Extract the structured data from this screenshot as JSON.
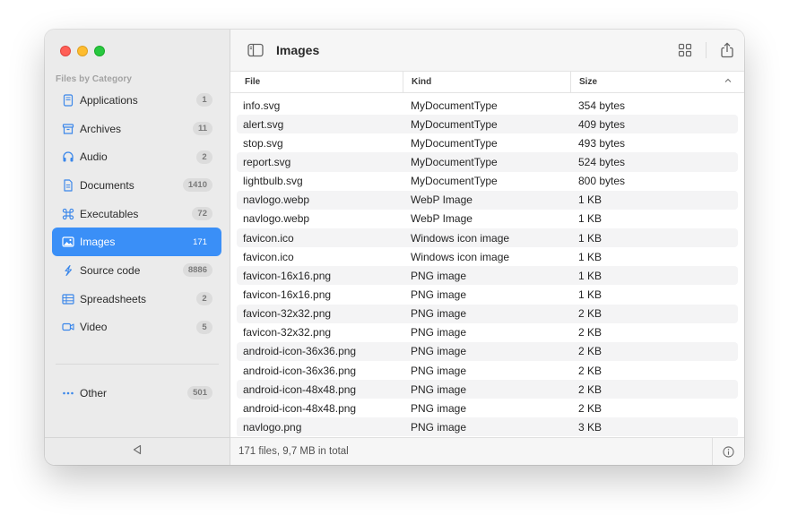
{
  "window": {
    "title": "Images"
  },
  "sidebar": {
    "section_title": "Files by Category",
    "items": [
      {
        "label": "Applications",
        "count": "1",
        "icon": "applications-icon",
        "active": false
      },
      {
        "label": "Archives",
        "count": "11",
        "icon": "archive-box-icon",
        "active": false
      },
      {
        "label": "Audio",
        "count": "2",
        "icon": "headphones-icon",
        "active": false
      },
      {
        "label": "Documents",
        "count": "1410",
        "icon": "document-icon",
        "active": false
      },
      {
        "label": "Executables",
        "count": "72",
        "icon": "command-icon",
        "active": false
      },
      {
        "label": "Images",
        "count": "171",
        "icon": "photo-icon",
        "active": true
      },
      {
        "label": "Source code",
        "count": "8886",
        "icon": "swift-icon",
        "active": false
      },
      {
        "label": "Spreadsheets",
        "count": "2",
        "icon": "table-icon",
        "active": false
      },
      {
        "label": "Video",
        "count": "5",
        "icon": "video-camera-icon",
        "active": false
      }
    ],
    "other": {
      "label": "Other",
      "count": "501",
      "icon": "ellipsis-icon"
    }
  },
  "toolbar": {
    "title": "Images",
    "sidebar_toggle_icon": "sidebar-toggle-icon",
    "grid_view_icon": "grid-view-icon",
    "share_icon": "share-icon"
  },
  "table": {
    "columns": {
      "file": "File",
      "kind": "Kind",
      "size": "Size"
    },
    "rows": [
      {
        "file": "info.svg",
        "kind": "MyDocumentType",
        "size": "354 bytes"
      },
      {
        "file": "alert.svg",
        "kind": "MyDocumentType",
        "size": "409 bytes"
      },
      {
        "file": "stop.svg",
        "kind": "MyDocumentType",
        "size": "493 bytes"
      },
      {
        "file": "report.svg",
        "kind": "MyDocumentType",
        "size": "524 bytes"
      },
      {
        "file": "lightbulb.svg",
        "kind": "MyDocumentType",
        "size": "800 bytes"
      },
      {
        "file": "navlogo.webp",
        "kind": "WebP Image",
        "size": "1 KB"
      },
      {
        "file": "navlogo.webp",
        "kind": "WebP Image",
        "size": "1 KB"
      },
      {
        "file": "favicon.ico",
        "kind": "Windows icon image",
        "size": "1 KB"
      },
      {
        "file": "favicon.ico",
        "kind": "Windows icon image",
        "size": "1 KB"
      },
      {
        "file": "favicon-16x16.png",
        "kind": "PNG image",
        "size": "1 KB"
      },
      {
        "file": "favicon-16x16.png",
        "kind": "PNG image",
        "size": "1 KB"
      },
      {
        "file": "favicon-32x32.png",
        "kind": "PNG image",
        "size": "2 KB"
      },
      {
        "file": "favicon-32x32.png",
        "kind": "PNG image",
        "size": "2 KB"
      },
      {
        "file": "android-icon-36x36.png",
        "kind": "PNG image",
        "size": "2 KB"
      },
      {
        "file": "android-icon-36x36.png",
        "kind": "PNG image",
        "size": "2 KB"
      },
      {
        "file": "android-icon-48x48.png",
        "kind": "PNG image",
        "size": "2 KB"
      },
      {
        "file": "android-icon-48x48.png",
        "kind": "PNG image",
        "size": "2 KB"
      },
      {
        "file": "navlogo.png",
        "kind": "PNG image",
        "size": "3 KB"
      }
    ]
  },
  "status": {
    "text": "171 files, 9,7 MB in total",
    "info_icon": "info-icon"
  },
  "colors": {
    "accent": "#3a8ff7",
    "sidebar_bg": "#ebebeb",
    "row_alt": "#f4f4f5"
  }
}
